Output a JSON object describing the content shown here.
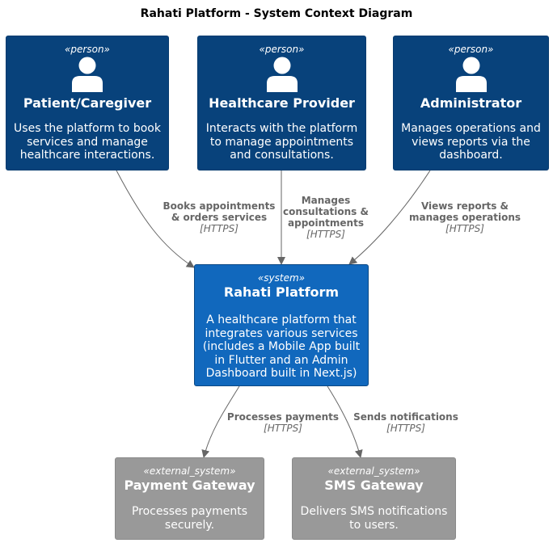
{
  "title": "Rahati Platform - System Context Diagram",
  "colors": {
    "person": "#08427b",
    "system": "#1168bd",
    "external_system": "#999999",
    "relationship": "#666666"
  },
  "persons": [
    {
      "stereotype": "«person»",
      "name": "Patient/Caregiver",
      "description": [
        "Uses the platform to book",
        "services and manage",
        "healthcare interactions."
      ]
    },
    {
      "stereotype": "«person»",
      "name": "Healthcare Provider",
      "description": [
        "Interacts with the platform",
        "to manage appointments",
        "and consultations."
      ]
    },
    {
      "stereotype": "«person»",
      "name": "Administrator",
      "description": [
        "Manages operations and",
        "views reports via the",
        "dashboard."
      ]
    }
  ],
  "system": {
    "stereotype": "«system»",
    "name": "Rahati Platform",
    "description": [
      "A healthcare platform that",
      "integrates various services",
      "(includes a Mobile App built",
      "in Flutter and an Admin",
      "Dashboard built in Next.js)"
    ]
  },
  "external_systems": [
    {
      "stereotype": "«external_system»",
      "name": "Payment Gateway",
      "description": [
        "Processes payments",
        "securely."
      ]
    },
    {
      "stereotype": "«external_system»",
      "name": "SMS Gateway",
      "description": [
        "Delivers SMS notifications",
        "to users."
      ]
    }
  ],
  "relationships": [
    {
      "from": "Patient/Caregiver",
      "to": "Rahati Platform",
      "label": [
        "Books appointments",
        "& orders services"
      ],
      "technology": "[HTTPS]"
    },
    {
      "from": "Healthcare Provider",
      "to": "Rahati Platform",
      "label": [
        "Manages",
        "consultations &",
        "appointments"
      ],
      "technology": "[HTTPS]"
    },
    {
      "from": "Administrator",
      "to": "Rahati Platform",
      "label": [
        "Views reports &",
        "manages operations"
      ],
      "technology": "[HTTPS]"
    },
    {
      "from": "Rahati Platform",
      "to": "Payment Gateway",
      "label": [
        "Processes payments"
      ],
      "technology": "[HTTPS]"
    },
    {
      "from": "Rahati Platform",
      "to": "SMS Gateway",
      "label": [
        "Sends notifications"
      ],
      "technology": "[HTTPS]"
    }
  ]
}
